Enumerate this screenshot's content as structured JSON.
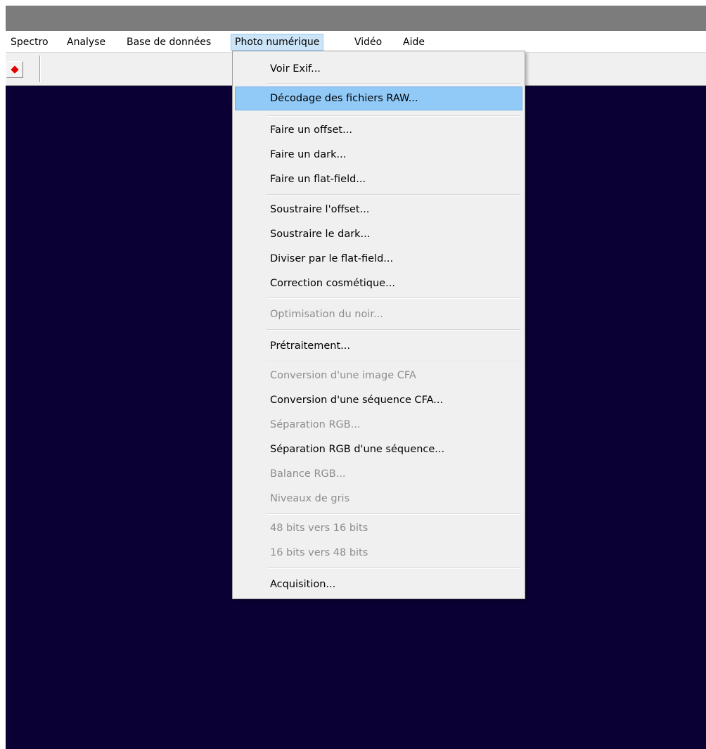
{
  "menubar": {
    "items": [
      {
        "label": "Spectro"
      },
      {
        "label": "Analyse"
      },
      {
        "label": "Base de données"
      },
      {
        "label": "Photo numérique"
      },
      {
        "label": "Vidéo"
      },
      {
        "label": "Aide"
      }
    ],
    "active_index": 3
  },
  "toolbar": {
    "button_icon": "red-diamond-icon"
  },
  "colors": {
    "workspace_background": "#0a0034",
    "highlight": "#91c9f7",
    "disabled_text": "#8d8d8d"
  },
  "dropdown": {
    "items": [
      {
        "label": "Voir Exif...",
        "enabled": true
      },
      {
        "label": "Décodage des fichiers RAW...",
        "enabled": true,
        "highlighted": true
      },
      {
        "label": "Faire un offset...",
        "enabled": true
      },
      {
        "label": "Faire un dark...",
        "enabled": true
      },
      {
        "label": "Faire un flat-field...",
        "enabled": true
      },
      {
        "label": "Soustraire l'offset...",
        "enabled": true
      },
      {
        "label": "Soustraire le dark...",
        "enabled": true
      },
      {
        "label": "Diviser par le flat-field...",
        "enabled": true
      },
      {
        "label": "Correction cosmétique...",
        "enabled": true
      },
      {
        "label": "Optimisation du noir...",
        "enabled": false
      },
      {
        "label": "Prétraitement...",
        "enabled": true
      },
      {
        "label": "Conversion d'une image CFA",
        "enabled": false
      },
      {
        "label": "Conversion d'une séquence CFA...",
        "enabled": true
      },
      {
        "label": "Séparation RGB...",
        "enabled": false
      },
      {
        "label": "Séparation RGB d'une séquence...",
        "enabled": true
      },
      {
        "label": "Balance RGB...",
        "enabled": false
      },
      {
        "label": "Niveaux de gris",
        "enabled": false
      },
      {
        "label": "48 bits vers 16 bits",
        "enabled": false
      },
      {
        "label": "16 bits vers 48 bits",
        "enabled": false
      },
      {
        "label": "Acquisition...",
        "enabled": true
      }
    ]
  }
}
